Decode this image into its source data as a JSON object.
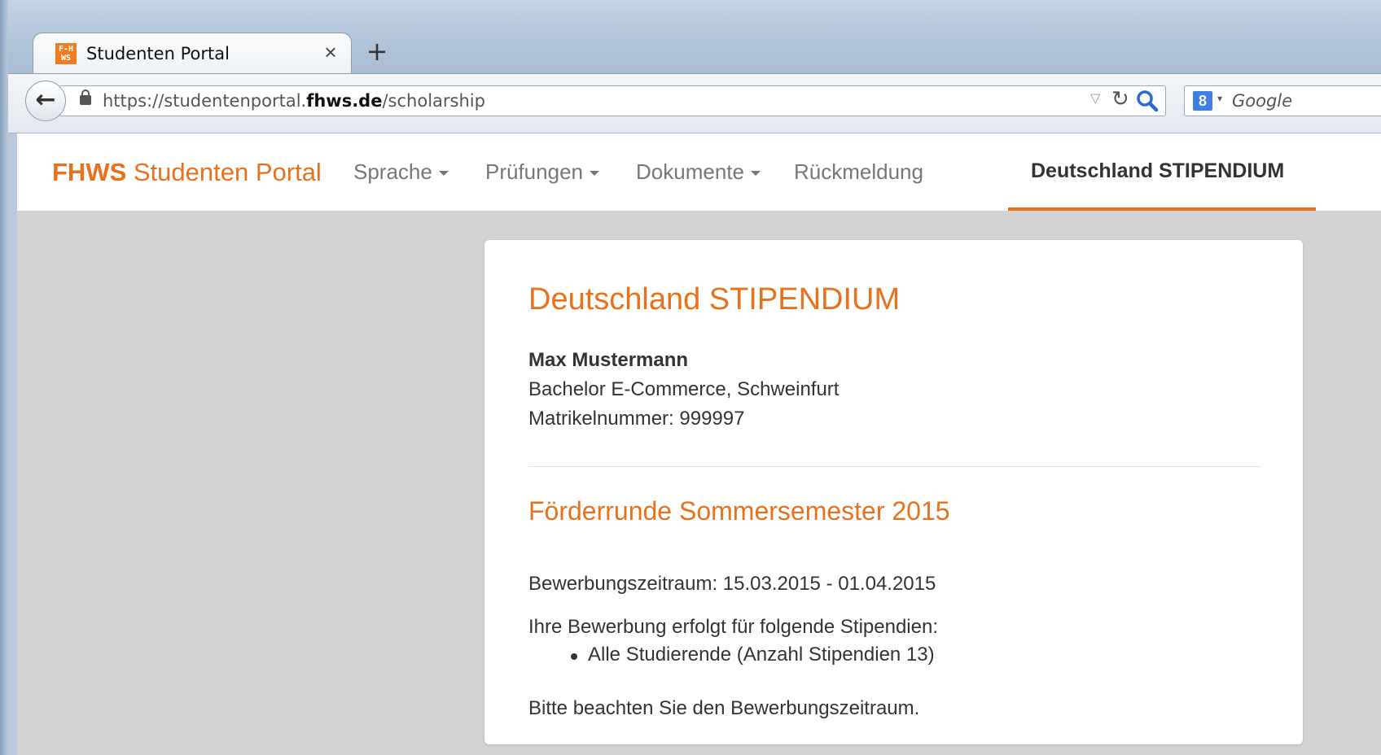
{
  "browser": {
    "tab_title": "Studenten Portal",
    "tab_close": "×",
    "new_tab": "+",
    "favicon_text": "F-H WS",
    "url_prefix": "https://studentenportal.",
    "url_domain": "fhws.de",
    "url_path": "/scholarship",
    "search_placeholder": "Google",
    "search_engine_badge": "8"
  },
  "site": {
    "brand_bold": "FHWS",
    "brand_rest": " Studenten Portal",
    "nav": [
      {
        "label": "Sprache",
        "dropdown": true
      },
      {
        "label": "Prüfungen",
        "dropdown": true
      },
      {
        "label": "Dokumente",
        "dropdown": true
      },
      {
        "label": "Rückmeldung",
        "dropdown": false
      },
      {
        "label": "Deutschland STIPENDIUM",
        "active": true
      }
    ],
    "accent_color": "#e8711c"
  },
  "card": {
    "title": "Deutschland STIPENDIUM",
    "student_name": "Max Mustermann",
    "program": "Bachelor E-Commerce, Schweinfurt",
    "matrikel": "Matrikelnummer: 999997",
    "round_title": "Förderrunde Sommersemester 2015",
    "period": "Bewerbungszeitraum: 15.03.2015 - 01.04.2015",
    "intro": "Ihre Bewerbung erfolgt für folgende Stipendien:",
    "scholarships": [
      "Alle Studierende (Anzahl Stipendien 13)"
    ],
    "note": "Bitte beachten Sie den Bewerbungszeitraum."
  }
}
